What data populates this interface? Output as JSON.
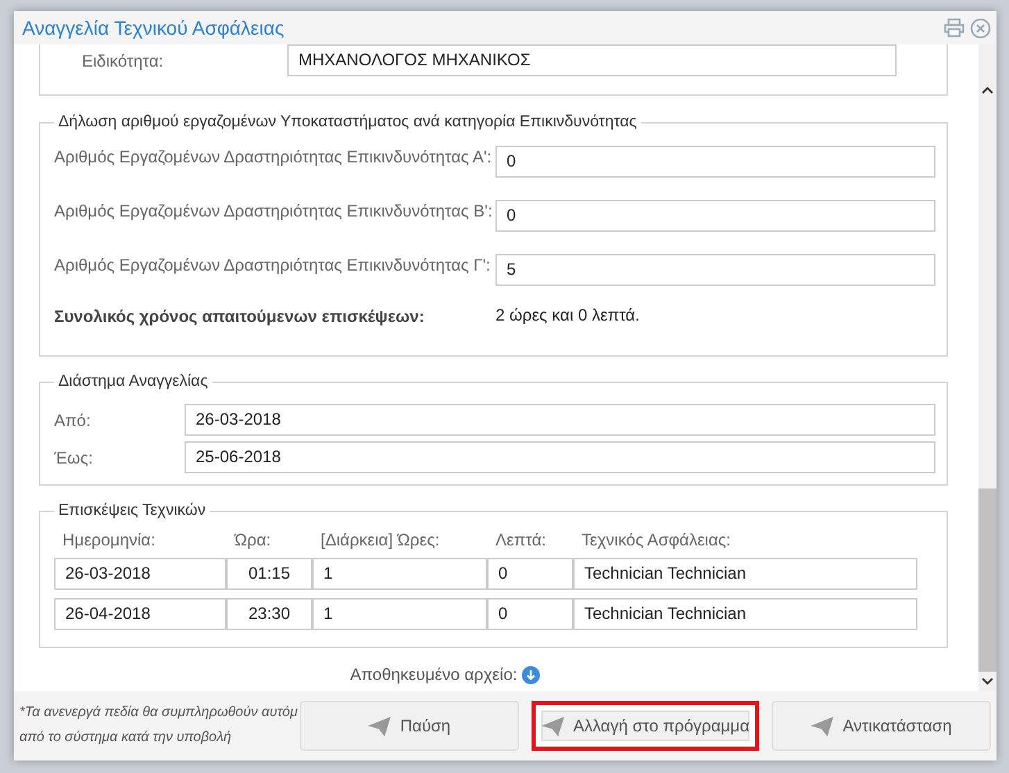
{
  "window": {
    "title": "Αναγγελία Τεχνικού Ασφάλειας"
  },
  "specialty": {
    "label": "Ειδικότητα:",
    "value": "ΜΗΧΑΝΟΛΟΓΟΣ ΜΗΧΑΝΙΚΟΣ"
  },
  "risk_section": {
    "legend": "Δήλωση αριθμού εργαζομένων Υποκαταστήματος ανά κατηγορία Επικινδυνότητας",
    "fields": [
      {
        "label": "Αριθμός Εργαζομένων Δραστηριότητας Επικινδυνότητας Α':",
        "value": "0"
      },
      {
        "label": "Αριθμός Εργαζομένων Δραστηριότητας Επικινδυνότητας Β':",
        "value": "0"
      },
      {
        "label": "Αριθμός Εργαζομένων Δραστηριότητας Επικινδυνότητας Γ':",
        "value": "5"
      }
    ],
    "total": {
      "label": "Συνολικός χρόνος απαιτούμενων επισκέψεων:",
      "value": "2 ώρες και 0 λεπτά."
    }
  },
  "period_section": {
    "legend": "Διάστημα Αναγγελίας",
    "fields": [
      {
        "label": "Από:",
        "value": "26-03-2018"
      },
      {
        "label": "Έως:",
        "value": "25-06-2018"
      }
    ]
  },
  "visits_section": {
    "legend": "Επισκέψεις Τεχνικών",
    "columns": [
      "Ημερομηνία:",
      "Ώρα:",
      "[Διάρκεια] Ώρες:",
      "Λεπτά:",
      "Τεχνικός Ασφάλειας:"
    ],
    "rows": [
      [
        "26-03-2018",
        "01:15",
        "1",
        "0",
        "Technician Technician"
      ],
      [
        "26-04-2018",
        "23:30",
        "1",
        "0",
        "Technician Technician"
      ]
    ]
  },
  "saved_file": {
    "label": "Αποθηκευμένο αρχείο:"
  },
  "footer": {
    "note_lines": [
      "*Τα ανενεργά πεδία θα συμπληρωθούν αυτόμ",
      "από το σύστημα κατά την υποβολή"
    ],
    "buttons": [
      {
        "label": "Παύση",
        "highlighted": false
      },
      {
        "label": "Αλλαγή στο πρόγραμμα",
        "highlighted": true
      },
      {
        "label": "Αντικατάσταση",
        "highlighted": false
      }
    ]
  }
}
